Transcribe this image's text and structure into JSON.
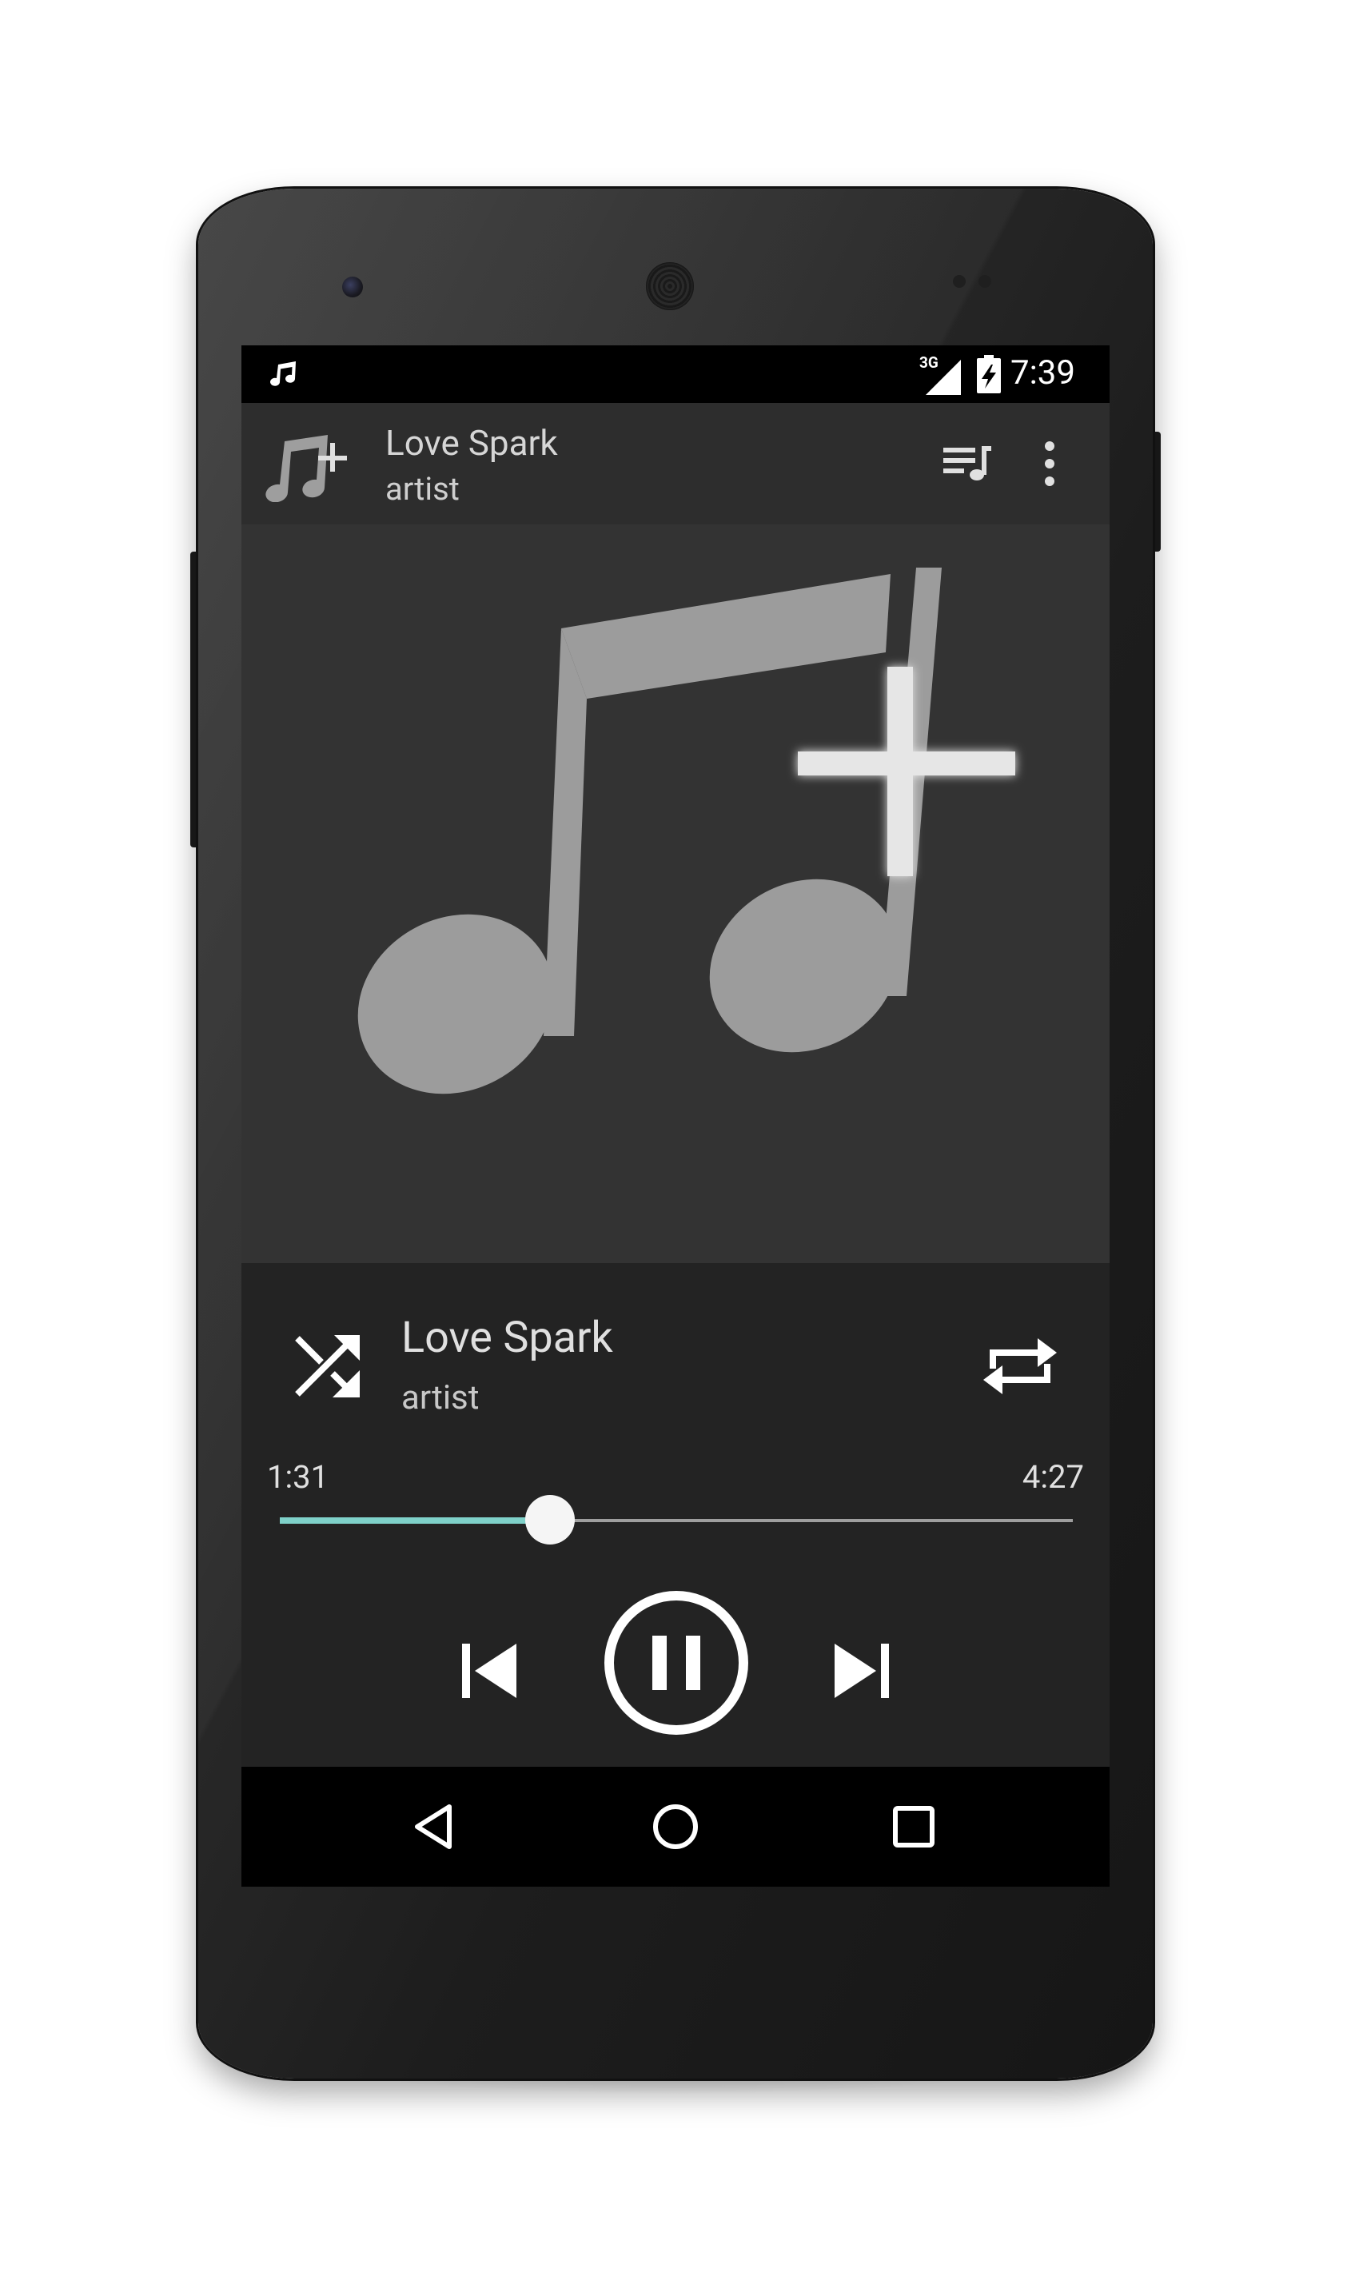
{
  "status_bar": {
    "network": "3G",
    "time": "7:39",
    "notification_icon": "music-note-icon",
    "signal_icon": "signal-icon",
    "battery_icon": "battery-charging-icon"
  },
  "app_bar": {
    "logo_icon": "music-plus-logo",
    "title": "Love Spark",
    "subtitle": "artist",
    "queue_icon": "queue-music-icon",
    "menu_icon": "more-vert-icon"
  },
  "album_art": {
    "icon": "music-note-plus-placeholder"
  },
  "player": {
    "track_title": "Love Spark",
    "track_artist": "artist",
    "shuffle_icon": "shuffle-icon",
    "repeat_icon": "repeat-icon",
    "elapsed": "1:31",
    "total": "4:27",
    "progress": 0.341,
    "prev_icon": "skip-previous-icon",
    "play_pause_icon": "pause-icon",
    "next_icon": "skip-next-icon"
  },
  "colors": {
    "accent": "#7fd1c9",
    "app_bar": "#2d2d2d",
    "album_bg": "#333333",
    "player_bg": "#232323",
    "status_bg": "#000000"
  },
  "nav_bar": {
    "back_icon": "back-icon",
    "home_icon": "home-icon",
    "recent_icon": "recent-apps-icon"
  }
}
